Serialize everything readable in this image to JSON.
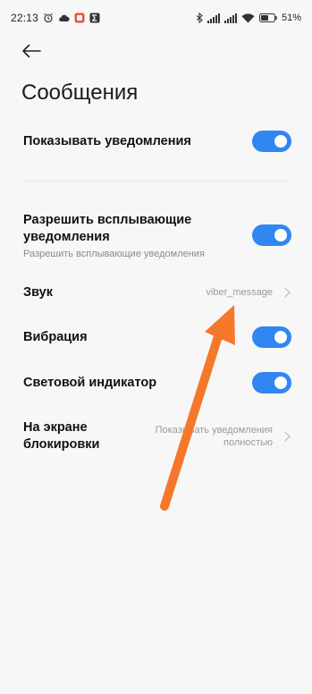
{
  "status_bar": {
    "time": "22:13",
    "battery": "51%",
    "icons": [
      "alarm-icon",
      "cloud-icon",
      "app-notification-icon",
      "sigma-icon",
      "bluetooth-icon",
      "signal-icon",
      "signal-icon",
      "wifi-icon",
      "battery-icon"
    ]
  },
  "header": {
    "back_icon": "arrow-left-icon",
    "title": "Сообщения"
  },
  "settings": {
    "show_notifications": {
      "label": "Показывать уведомления",
      "enabled": true
    },
    "allow_popups": {
      "label": "Разрешить всплывающие уведомления",
      "sublabel": "Разрешить всплывающие уведомления",
      "enabled": true
    },
    "sound": {
      "label": "Звук",
      "value": "viber_message"
    },
    "vibration": {
      "label": "Вибрация",
      "enabled": true
    },
    "led_indicator": {
      "label": "Световой индикатор",
      "enabled": true
    },
    "lock_screen": {
      "label": "На экране блокировки",
      "value": "Показывать уведомления полностью"
    }
  },
  "colors": {
    "toggle_on": "#3286f2",
    "annotation_arrow": "#f5782a",
    "background": "#f7f7f7"
  }
}
